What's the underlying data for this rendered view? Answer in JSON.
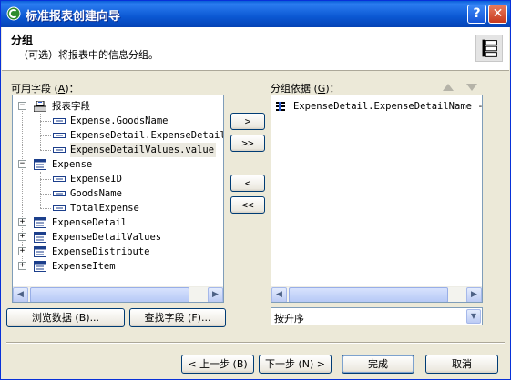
{
  "window": {
    "title": "标准报表创建向导"
  },
  "header": {
    "title": "分组",
    "subtitle": "（可选）将报表中的信息分组。"
  },
  "available": {
    "label_pre": "可用字段 (",
    "label_key": "A",
    "label_post": ")：",
    "tree": [
      {
        "text": "报表字段",
        "kind": "root",
        "expanded": true
      },
      {
        "text": "Expense.GoodsName",
        "kind": "field"
      },
      {
        "text": "ExpenseDetail.ExpenseDetailN",
        "kind": "field"
      },
      {
        "text": "ExpenseDetailValues.value",
        "kind": "field",
        "selected": true
      },
      {
        "text": "Expense",
        "kind": "table",
        "expanded": true
      },
      {
        "text": "ExpenseID",
        "kind": "field"
      },
      {
        "text": "GoodsName",
        "kind": "field"
      },
      {
        "text": "TotalExpense",
        "kind": "field"
      },
      {
        "text": "ExpenseDetail",
        "kind": "table",
        "expanded": false
      },
      {
        "text": "ExpenseDetailValues",
        "kind": "table",
        "expanded": false
      },
      {
        "text": "ExpenseDistribute",
        "kind": "table",
        "expanded": false
      },
      {
        "text": "ExpenseItem",
        "kind": "table",
        "expanded": false
      }
    ]
  },
  "groupby": {
    "label_pre": "分组依据 (",
    "label_key": "G",
    "label_post": ")：",
    "items": [
      {
        "text": "ExpenseDetail.ExpenseDetailName - A"
      }
    ],
    "sort_value": "按升序"
  },
  "transfer": {
    "add": ">",
    "add_all": ">>",
    "remove": "<",
    "remove_all": "<<"
  },
  "buttons": {
    "browse": "浏览数据 (B)...",
    "find": "查找字段 (F)...",
    "back": "< 上一步 (B)",
    "next": "下一步 (N) >",
    "finish": "完成",
    "cancel": "取消"
  },
  "colors": {
    "title_blue": "#0b58d3",
    "face": "#ece9d8",
    "border_blue": "#7f9db9"
  }
}
